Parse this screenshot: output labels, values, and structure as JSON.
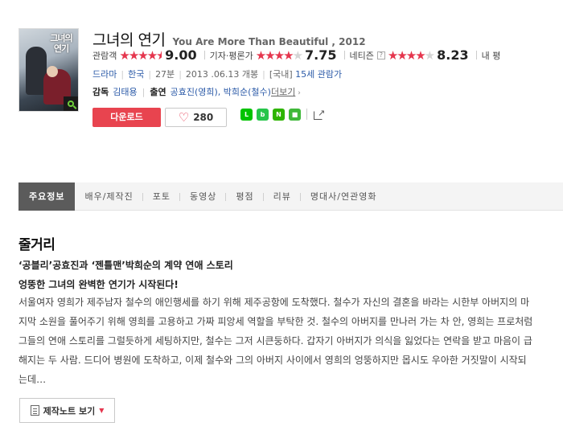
{
  "poster": {
    "title_text": "그녀의 연기"
  },
  "movie": {
    "title_kr": "그녀의 연기",
    "title_en": "You Are More Than Beautiful , 2012"
  },
  "ratings": [
    {
      "label": "관람객",
      "score": "9.00",
      "help": "",
      "stars": 4.5
    },
    {
      "label": "기자·평론가",
      "score": "7.75",
      "help": "?",
      "stars": 4
    },
    {
      "label": "네티즌",
      "score": "8.23",
      "help": "?",
      "stars": 4
    },
    {
      "label": "내 평",
      "score": "",
      "help": "",
      "stars": 0
    }
  ],
  "meta": {
    "genre": "드라마",
    "country": "한국",
    "runtime": "27분",
    "release": "2013 .06.13 개봉",
    "grade_prefix": "[국내]",
    "grade": "15세 관람가"
  },
  "credits": {
    "director_label": "감독",
    "director": "김태용",
    "cast_label": "출연",
    "cast": "공효진(영희), 박희순(철수)",
    "more": "더보기"
  },
  "actions": {
    "download_label": "다운로드",
    "like_count": "280"
  },
  "share": {
    "icons": [
      "line-icon",
      "band-icon",
      "blog-icon",
      "cafe-icon",
      "share-icon"
    ]
  },
  "tabs": [
    "주요정보",
    "배우/제작진",
    "포토",
    "동영상",
    "평점",
    "리뷰",
    "명대사/연관영화"
  ],
  "synopsis": {
    "heading": "줄거리",
    "tagline1": "‘공블리’공효진과 ‘젠틀맨’박희순의 계약 연애 스토리",
    "tagline2": "엉뚱한 그녀의 완벽한 연기가 시작된다!",
    "body": "서울여자 영희가 제주남자 철수의 애인행세를 하기 위해 제주공항에 도착했다. 철수가 자신의 결혼을 바라는 시한부 아버지의 마지막 소원을 풀어주기 위해 영희를 고용하고 가짜 피앙세 역할을 부탁한 것. 철수의 아버지를 만나러 가는 차 안, 영희는 프로처럼 그들의 연애 스토리를 그럴듯하게 세팅하지만, 철수는 그저 시큰둥하다. 갑자기 아버지가 의식을 잃었다는 연락을 받고 마음이 급해지는 두 사람. 드디어 병원에 도착하고, 이제 철수와 그의 아버지 사이에서 영희의 엉뚱하지만 몹시도 우아한 거짓말이 시작되는데…",
    "notes_label": "제작노트 보기"
  },
  "colors": {
    "accent": "#e8444f",
    "link": "#2c5ba8",
    "tab_active": "#5b5b5b"
  }
}
